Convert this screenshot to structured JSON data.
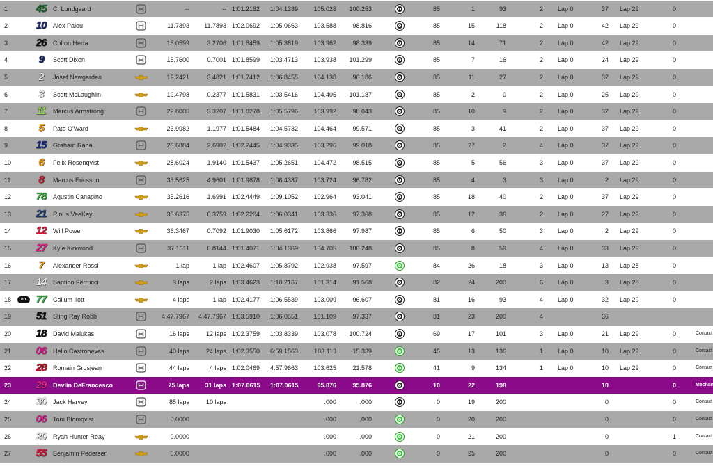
{
  "colors": {
    "row_gray": "#a9a9a9",
    "row_white": "#ffffff",
    "row_highlight": "#8a0a8a"
  },
  "rows": [
    {
      "pos": "1",
      "num": "45",
      "num_color": "#1e6a2a",
      "driver": "C. Lundgaard",
      "eng": "honda",
      "gap": "--",
      "int": "--",
      "last": "1:01.2182",
      "best": "1:04.1339",
      "s1": "105.028",
      "s2": "100.253",
      "tire": "primary",
      "laps": "85",
      "c1": "1",
      "c2": "93",
      "pits": "2",
      "lp1": "Lap 0",
      "c3": "37",
      "lp2": "Lap 29",
      "c4": "0",
      "status": "",
      "style": "gray"
    },
    {
      "pos": "2",
      "num": "10",
      "num_color": "#1a2a6a",
      "driver": "Alex Palou",
      "eng": "honda",
      "gap": "11.7893",
      "int": "11.7893",
      "last": "1:02.0692",
      "best": "1:05.0663",
      "s1": "103.588",
      "s2": "98.816",
      "tire": "primary",
      "laps": "85",
      "c1": "15",
      "c2": "118",
      "pits": "2",
      "lp1": "Lap 0",
      "c3": "42",
      "lp2": "Lap 29",
      "c4": "0",
      "status": "",
      "style": "white"
    },
    {
      "pos": "3",
      "num": "26",
      "num_color": "#111111",
      "driver": "Colton Herta",
      "eng": "honda",
      "gap": "15.0599",
      "int": "3.2706",
      "last": "1:01.8459",
      "best": "1:05.3819",
      "s1": "103.962",
      "s2": "98.339",
      "tire": "primary",
      "laps": "85",
      "c1": "14",
      "c2": "71",
      "pits": "2",
      "lp1": "Lap 0",
      "c3": "42",
      "lp2": "Lap 29",
      "c4": "0",
      "status": "",
      "style": "gray"
    },
    {
      "pos": "4",
      "num": "9",
      "num_color": "#1a2a6a",
      "driver": "Scott Dixon",
      "eng": "honda",
      "gap": "15.7600",
      "int": "0.7001",
      "last": "1:01.8599",
      "best": "1:03.4713",
      "s1": "103.938",
      "s2": "101.299",
      "tire": "primary",
      "laps": "85",
      "c1": "7",
      "c2": "16",
      "pits": "2",
      "lp1": "Lap 0",
      "c3": "24",
      "lp2": "Lap 29",
      "c4": "0",
      "status": "",
      "style": "white"
    },
    {
      "pos": "5",
      "num": "2",
      "num_color": "#e8e8e8",
      "driver": "Josef Newgarden",
      "eng": "chevy",
      "gap": "19.2421",
      "int": "3.4821",
      "last": "1:01.7412",
      "best": "1:06.8455",
      "s1": "104.138",
      "s2": "96.186",
      "tire": "primary",
      "laps": "85",
      "c1": "11",
      "c2": "27",
      "pits": "2",
      "lp1": "Lap 0",
      "c3": "37",
      "lp2": "Lap 29",
      "c4": "0",
      "status": "",
      "style": "gray"
    },
    {
      "pos": "6",
      "num": "3",
      "num_color": "#e8e8e8",
      "driver": "Scott McLaughlin",
      "eng": "chevy",
      "gap": "19.4798",
      "int": "0.2377",
      "last": "1:01.5831",
      "best": "1:03.5416",
      "s1": "104.405",
      "s2": "101.187",
      "tire": "primary",
      "laps": "85",
      "c1": "2",
      "c2": "0",
      "pits": "2",
      "lp1": "Lap 0",
      "c3": "25",
      "lp2": "Lap 29",
      "c4": "0",
      "status": "",
      "style": "white"
    },
    {
      "pos": "7",
      "num": "11",
      "num_color": "#8fd14f",
      "driver": "Marcus Armstrong",
      "eng": "honda",
      "gap": "22.8005",
      "int": "3.3207",
      "last": "1:01.8278",
      "best": "1:05.5796",
      "s1": "103.992",
      "s2": "98.043",
      "tire": "primary",
      "laps": "85",
      "c1": "10",
      "c2": "9",
      "pits": "2",
      "lp1": "Lap 0",
      "c3": "37",
      "lp2": "Lap 29",
      "c4": "0",
      "status": "",
      "style": "gray"
    },
    {
      "pos": "8",
      "num": "5",
      "num_color": "#f39c12",
      "driver": "Pato O'Ward",
      "eng": "chevy",
      "gap": "23.9982",
      "int": "1.1977",
      "last": "1:01.5484",
      "best": "1:04.5732",
      "s1": "104.464",
      "s2": "99.571",
      "tire": "primary",
      "laps": "85",
      "c1": "3",
      "c2": "41",
      "pits": "2",
      "lp1": "Lap 0",
      "c3": "37",
      "lp2": "Lap 29",
      "c4": "0",
      "status": "",
      "style": "white"
    },
    {
      "pos": "9",
      "num": "15",
      "num_color": "#1a2a8a",
      "driver": "Graham Rahal",
      "eng": "honda",
      "gap": "26.6884",
      "int": "2.6902",
      "last": "1:02.2445",
      "best": "1:04.9335",
      "s1": "103.296",
      "s2": "99.018",
      "tire": "primary",
      "laps": "85",
      "c1": "27",
      "c2": "2",
      "pits": "4",
      "lp1": "Lap 0",
      "c3": "37",
      "lp2": "Lap 29",
      "c4": "0",
      "status": "",
      "style": "gray"
    },
    {
      "pos": "10",
      "num": "6",
      "num_color": "#f39c12",
      "driver": "Felix Rosenqvist",
      "eng": "chevy",
      "gap": "28.6024",
      "int": "1.9140",
      "last": "1:01.5437",
      "best": "1:05.2651",
      "s1": "104.472",
      "s2": "98.515",
      "tire": "primary",
      "laps": "85",
      "c1": "5",
      "c2": "56",
      "pits": "3",
      "lp1": "Lap 0",
      "c3": "37",
      "lp2": "Lap 29",
      "c4": "0",
      "status": "",
      "style": "white"
    },
    {
      "pos": "11",
      "num": "8",
      "num_color": "#c0162a",
      "driver": "Marcus Ericsson",
      "eng": "honda",
      "gap": "33.5625",
      "int": "4.9601",
      "last": "1:01.9878",
      "best": "1:06.4337",
      "s1": "103.724",
      "s2": "96.782",
      "tire": "primary",
      "laps": "85",
      "c1": "4",
      "c2": "3",
      "pits": "3",
      "lp1": "Lap 0",
      "c3": "2",
      "lp2": "Lap 29",
      "c4": "0",
      "status": "",
      "style": "gray"
    },
    {
      "pos": "12",
      "num": "78",
      "num_color": "#3cb043",
      "driver": "Agustin Canapino",
      "eng": "chevy",
      "gap": "35.2616",
      "int": "1.6991",
      "last": "1:02.4449",
      "best": "1:09.1052",
      "s1": "102.964",
      "s2": "93.041",
      "tire": "primary",
      "laps": "85",
      "c1": "18",
      "c2": "40",
      "pits": "2",
      "lp1": "Lap 0",
      "c3": "37",
      "lp2": "Lap 29",
      "c4": "0",
      "status": "",
      "style": "white"
    },
    {
      "pos": "13",
      "num": "21",
      "num_color": "#1a3a6a",
      "driver": "Rinus VeeKay",
      "eng": "chevy",
      "gap": "36.6375",
      "int": "0.3759",
      "last": "1:02.2204",
      "best": "1:06.0341",
      "s1": "103.336",
      "s2": "97.368",
      "tire": "primary",
      "laps": "85",
      "c1": "12",
      "c2": "36",
      "pits": "2",
      "lp1": "Lap 0",
      "c3": "27",
      "lp2": "Lap 29",
      "c4": "0",
      "status": "",
      "style": "gray"
    },
    {
      "pos": "14",
      "num": "12",
      "num_color": "#d81b3a",
      "driver": "Will Power",
      "eng": "chevy",
      "gap": "36.3467",
      "int": "0.7092",
      "last": "1:01.9030",
      "best": "1:05.6172",
      "s1": "103.866",
      "s2": "97.987",
      "tire": "primary",
      "laps": "85",
      "c1": "6",
      "c2": "50",
      "pits": "3",
      "lp1": "Lap 0",
      "c3": "2",
      "lp2": "Lap 29",
      "c4": "0",
      "status": "",
      "style": "white"
    },
    {
      "pos": "15",
      "num": "27",
      "num_color": "#e91e8c",
      "driver": "Kyle Kirkwood",
      "eng": "honda",
      "gap": "37.1611",
      "int": "0.8144",
      "last": "1:01.4071",
      "best": "1:04.1369",
      "s1": "104.705",
      "s2": "100.248",
      "tire": "primary",
      "laps": "85",
      "c1": "8",
      "c2": "59",
      "pits": "4",
      "lp1": "Lap 0",
      "c3": "33",
      "lp2": "Lap 29",
      "c4": "0",
      "status": "",
      "style": "gray"
    },
    {
      "pos": "16",
      "num": "7",
      "num_color": "#f39c12",
      "driver": "Alexander Rossi",
      "eng": "chevy",
      "gap": "1 lap",
      "int": "1 lap",
      "last": "1:02.4607",
      "best": "1:05.8792",
      "s1": "102.938",
      "s2": "97.597",
      "tire": "alternate",
      "laps": "84",
      "c1": "26",
      "c2": "18",
      "pits": "3",
      "lp1": "Lap 0",
      "c3": "13",
      "lp2": "Lap 28",
      "c4": "0",
      "status": "",
      "style": "white"
    },
    {
      "pos": "17",
      "num": "14",
      "num_color": "#e8e8e8",
      "driver": "Santino Ferrucci",
      "eng": "chevy",
      "gap": "3 laps",
      "int": "2 laps",
      "last": "1:03.4623",
      "best": "1:10.2167",
      "s1": "101.314",
      "s2": "91.568",
      "tire": "primary",
      "laps": "82",
      "c1": "24",
      "c2": "200",
      "pits": "6",
      "lp1": "Lap 0",
      "c3": "3",
      "lp2": "Lap 28",
      "c4": "0",
      "status": "",
      "style": "gray"
    },
    {
      "pos": "18",
      "num": "77",
      "num_color": "#3cb043",
      "pit": "PIT",
      "driver": "Callum Ilott",
      "eng": "chevy",
      "gap": "4 laps",
      "int": "1 lap",
      "last": "1:02.4177",
      "best": "1:06.5539",
      "s1": "103.009",
      "s2": "96.607",
      "tire": "primary",
      "laps": "81",
      "c1": "16",
      "c2": "93",
      "pits": "4",
      "lp1": "Lap 0",
      "c3": "32",
      "lp2": "Lap 29",
      "c4": "0",
      "status": "",
      "style": "white"
    },
    {
      "pos": "19",
      "num": "51",
      "num_color": "#111111",
      "driver": "Sting Ray Robb",
      "eng": "honda",
      "gap": "4:47.7967",
      "int": "4:47.7967",
      "last": "1:03.5910",
      "best": "1:06.0551",
      "s1": "101.109",
      "s2": "97.337",
      "tire": "primary",
      "laps": "81",
      "c1": "23",
      "c2": "200",
      "pits": "4",
      "lp1": "",
      "c3": "36",
      "lp2": "",
      "c4": "",
      "status": "",
      "style": "gray"
    },
    {
      "pos": "20",
      "num": "18",
      "num_color": "#111111",
      "driver": "David Malukas",
      "eng": "honda",
      "gap": "16 laps",
      "int": "12 laps",
      "last": "1:02.3759",
      "best": "1:03.8339",
      "s1": "103.078",
      "s2": "100.724",
      "tire": "primary",
      "laps": "69",
      "c1": "17",
      "c2": "101",
      "pits": "3",
      "lp1": "Lap 0",
      "c3": "21",
      "lp2": "Lap 29",
      "c4": "0",
      "status": "Contact",
      "style": "white"
    },
    {
      "pos": "21",
      "num": "06",
      "num_color": "#d81b8a",
      "driver": "Helio Castroneves",
      "eng": "honda",
      "gap": "40 laps",
      "int": "24 laps",
      "last": "1:02.3550",
      "best": "6:59.1563",
      "s1": "103.113",
      "s2": "15.339",
      "tire": "alternate",
      "laps": "45",
      "c1": "13",
      "c2": "136",
      "pits": "1",
      "lp1": "Lap 0",
      "c3": "10",
      "lp2": "Lap 29",
      "c4": "0",
      "status": "Contact",
      "style": "gray"
    },
    {
      "pos": "22",
      "num": "28",
      "num_color": "#c0162a",
      "driver": "Romain Grosjean",
      "eng": "honda",
      "gap": "44 laps",
      "int": "4 laps",
      "last": "1:02.0469",
      "best": "4:57.9663",
      "s1": "103.625",
      "s2": "21.578",
      "tire": "alternate",
      "laps": "41",
      "c1": "9",
      "c2": "134",
      "pits": "1",
      "lp1": "Lap 0",
      "c3": "10",
      "lp2": "Lap 29",
      "c4": "0",
      "status": "Contact",
      "style": "white"
    },
    {
      "pos": "23",
      "num": "29",
      "num_color": "#e91e8c",
      "driver": "Devlin DeFrancesco",
      "eng": "honda",
      "gap": "75 laps",
      "int": "31 laps",
      "last": "1:07.0615",
      "best": "1:07.0615",
      "s1": "95.876",
      "s2": "95.876",
      "tire": "primary",
      "laps": "10",
      "c1": "22",
      "c2": "198",
      "pits": "",
      "lp1": "",
      "c3": "10",
      "lp2": "",
      "c4": "0",
      "status": "Mechanical",
      "style": "hl"
    },
    {
      "pos": "24",
      "num": "30",
      "num_color": "#e8e8e8",
      "driver": "Jack Harvey",
      "eng": "honda",
      "gap": "85 laps",
      "int": "10 laps",
      "last": "",
      "best": "",
      "s1": ".000",
      "s2": ".000",
      "tire": "primary",
      "laps": "0",
      "c1": "19",
      "c2": "200",
      "pits": "",
      "lp1": "",
      "c3": "0",
      "lp2": "",
      "c4": "0",
      "status": "Contact",
      "style": "white"
    },
    {
      "pos": "25",
      "num": "06",
      "num_color": "#d81b8a",
      "driver": "Tom Blomqvist",
      "eng": "honda",
      "gap": "0.0000",
      "int": "",
      "last": "",
      "best": "",
      "s1": ".000",
      "s2": ".000",
      "tire": "alternate",
      "laps": "0",
      "c1": "20",
      "c2": "200",
      "pits": "",
      "lp1": "",
      "c3": "0",
      "lp2": "",
      "c4": "0",
      "status": "Contact",
      "style": "gray"
    },
    {
      "pos": "26",
      "num": "20",
      "num_color": "#e8e8e8",
      "driver": "Ryan Hunter-Reay",
      "eng": "chevy",
      "gap": "0.0000",
      "int": "",
      "last": "",
      "best": "",
      "s1": ".000",
      "s2": ".000",
      "tire": "alternate",
      "laps": "0",
      "c1": "21",
      "c2": "200",
      "pits": "",
      "lp1": "",
      "c3": "0",
      "lp2": "",
      "c4": "1",
      "status": "Contact",
      "style": "white"
    },
    {
      "pos": "27",
      "num": "55",
      "num_color": "#d81b3a",
      "driver": "Benjamin Pedersen",
      "eng": "chevy",
      "gap": "0.0000",
      "int": "",
      "last": "",
      "best": "",
      "s1": ".000",
      "s2": ".000",
      "tire": "alternate",
      "laps": "0",
      "c1": "25",
      "c2": "200",
      "pits": "",
      "lp1": "",
      "c3": "0",
      "lp2": "",
      "c4": "0",
      "status": "Contact",
      "style": "gray"
    }
  ]
}
